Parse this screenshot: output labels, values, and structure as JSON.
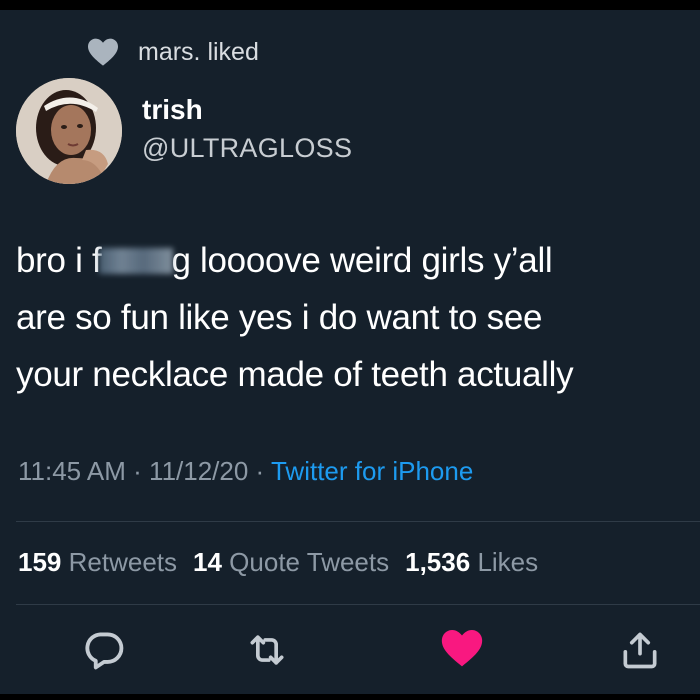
{
  "social_context": {
    "text": "mars. liked",
    "icon": "heart-icon"
  },
  "author": {
    "display_name": "trish",
    "handle": "@ULTRAGLOSS",
    "avatar": "avatar"
  },
  "tweet": {
    "line1_before": "bro i f",
    "line1_after": "g loooove weird girls y’all",
    "line2": "are so fun like yes i do want to see",
    "line3": "your necklace made of teeth actually"
  },
  "meta": {
    "time": "11:45 AM",
    "separator": " · ",
    "date": "11/12/20",
    "source": "Twitter for iPhone"
  },
  "stats": {
    "retweets_count": "159",
    "retweets_label": "Retweets",
    "quotes_count": "14",
    "quotes_label": "Quote Tweets",
    "likes_count": "1,536",
    "likes_label": "Likes"
  },
  "actions": {
    "reply_icon": "reply-icon",
    "retweet_icon": "retweet-icon",
    "like_icon": "like-icon",
    "share_icon": "share-icon"
  },
  "colors": {
    "background": "#15202b",
    "link": "#1d9bf0",
    "like": "#f91880",
    "muted": "#8d99a5"
  }
}
